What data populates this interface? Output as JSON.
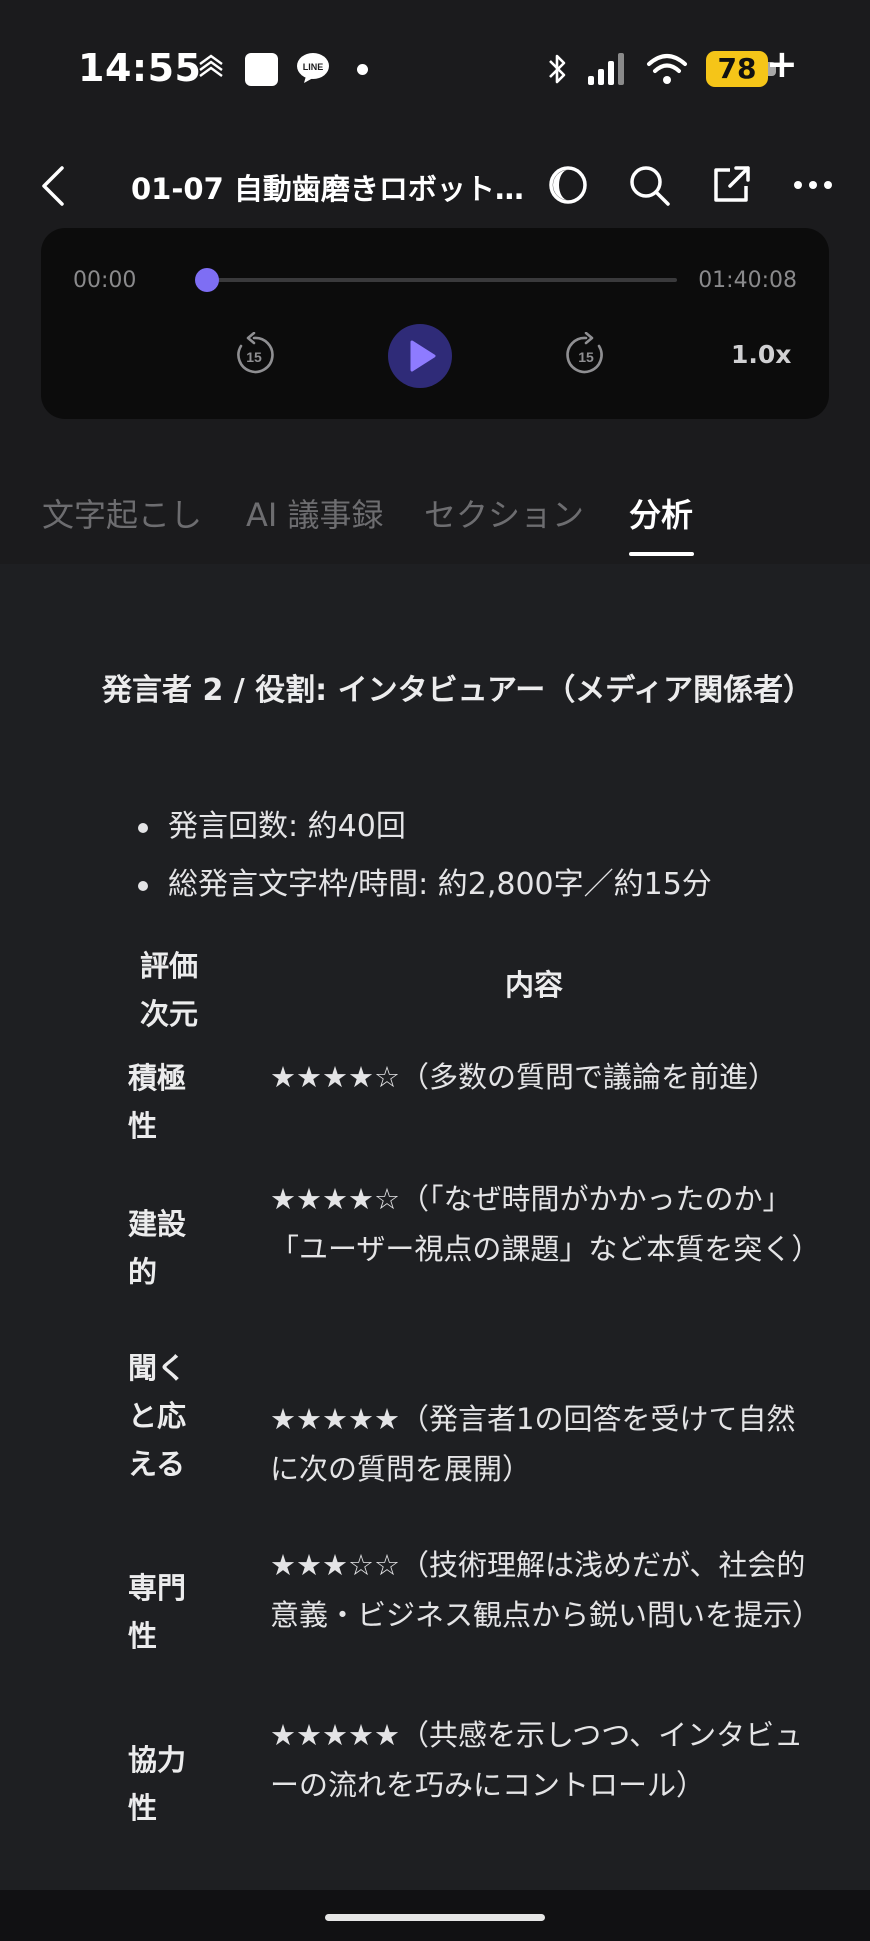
{
  "status_bar": {
    "time": "14:55",
    "battery_level": "78",
    "battery_color": "#f5c518",
    "icons": [
      "stack-icon",
      "square-app-icon",
      "line-app-icon",
      "notification-dot-icon",
      "bluetooth-icon",
      "signal-icon",
      "wifi-icon",
      "battery-icon",
      "charging-plus-icon"
    ]
  },
  "header": {
    "title": "01-07 自動歯磨きロボット…",
    "icons": [
      "back-icon",
      "theme-toggle-icon",
      "search-icon",
      "share-icon",
      "more-icon"
    ]
  },
  "player": {
    "current_time": "00:00",
    "total_time": "01:40:08",
    "progress": 0,
    "rewind_label": "15",
    "forward_label": "15",
    "speed": "1.0x",
    "accent_color": "#7e6ef4"
  },
  "tabs": [
    {
      "label": "文字起こし",
      "active": false
    },
    {
      "label": "AI 議事録",
      "active": false
    },
    {
      "label": "セクション",
      "active": false
    },
    {
      "label": "分析",
      "active": true
    }
  ],
  "analysis": {
    "speaker_heading": "発言者 2 / 役割: インタビュアー（メディア関係者）",
    "bullets": [
      "発言回数: 約40回",
      "総発言文字枠/時間: 約2,800字／約15分"
    ],
    "table": {
      "header_dimension": "評価次元",
      "header_content": "内容",
      "rows": [
        {
          "dimension": "積極性",
          "content": "★★★★☆（多数の質問で議論を前進）"
        },
        {
          "dimension": "建設的",
          "content": "★★★★☆（「なぜ時間がかかったのか」「ユーザー視点の課題」など本質を突く）"
        },
        {
          "dimension": "聞くと応える",
          "content": "★★★★★（発言者1の回答を受けて自然に次の質問を展開）"
        },
        {
          "dimension": "専門性",
          "content": "★★★☆☆（技術理解は浅めだが、社会的意義・ビジネス観点から鋭い問いを提示）"
        },
        {
          "dimension": "協力性",
          "content": "★★★★★（共感を示しつつ、インタビューの流れを巧みにコントロール）"
        }
      ]
    }
  }
}
